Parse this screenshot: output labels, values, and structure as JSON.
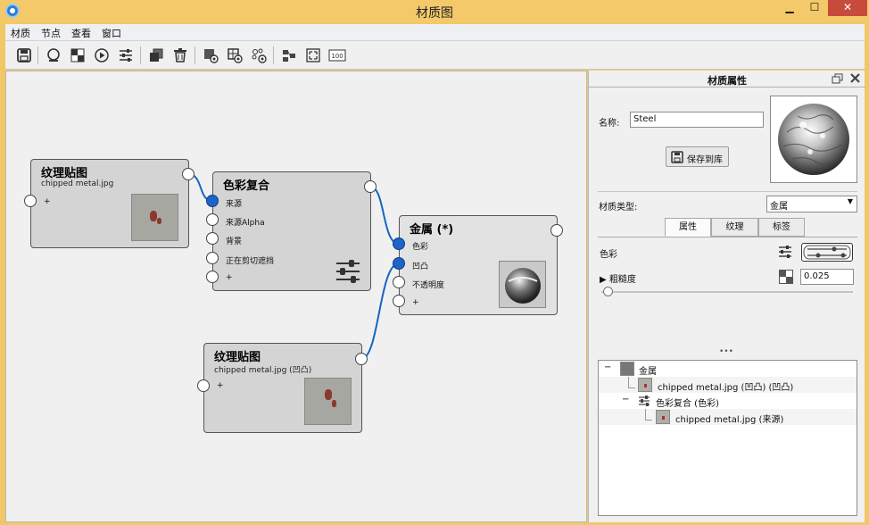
{
  "window": {
    "title": "材质图",
    "min_icon": "▁",
    "max_icon": "☐",
    "close_icon": "✕"
  },
  "menu": [
    "材质",
    "节点",
    "查看",
    "窗口"
  ],
  "toolbar": {
    "buttons": [
      "save-icon",
      "sphere-icon",
      "checker-icon",
      "play-icon",
      "sliders-icon",
      "duplicate-icon",
      "delete-icon",
      "add-material-icon",
      "add-texture-icon",
      "add-node-icon",
      "layout-icon",
      "fit-icon",
      "zoom-100-icon"
    ],
    "zoom_label": "100"
  },
  "nodes": {
    "texture1": {
      "title": "纹理贴图",
      "subtitle": "chipped metal.jpg",
      "add": "+"
    },
    "color_mix": {
      "title": "色彩复合",
      "ports": [
        "来源",
        "来源Alpha",
        "背景",
        "正在剪切遮挡",
        "+"
      ]
    },
    "metal": {
      "title": "金属 (*)",
      "ports": [
        "色彩",
        "凹凸",
        "不透明度",
        "+"
      ]
    },
    "texture2": {
      "title": "纹理贴图",
      "subtitle": "chipped metal.jpg (凹凸)",
      "add": "+"
    }
  },
  "panel": {
    "title": "材质属性",
    "name_label": "名称:",
    "name_value": "Steel",
    "save_button": "保存到库",
    "material_type_label": "材质类型:",
    "material_type_value": "金属",
    "tabs": [
      "属性",
      "纹理",
      "标签"
    ],
    "color_label": "色彩",
    "roughness_label": "粗糙度",
    "roughness_value": "0.025",
    "roughness_fraction": 0.025,
    "more_dots": "•••",
    "tree": [
      {
        "toggle": "−",
        "label": "金属"
      },
      {
        "toggle": "",
        "label": "chipped metal.jpg (凹凸) (凹凸)"
      },
      {
        "toggle": "−",
        "label": "色彩复合 (色彩)"
      },
      {
        "toggle": "",
        "label": "chipped metal.jpg (来源)"
      }
    ]
  },
  "colors": {
    "titlebar": "#f3c96a",
    "wire": "#1565c0",
    "connected_port": "#1e64c8",
    "close_button": "#c74b3b"
  }
}
